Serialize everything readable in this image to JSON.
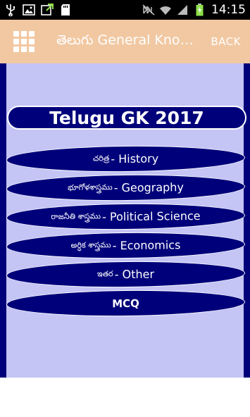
{
  "status_bar": {
    "time": "14:15",
    "icons": [
      "usb-icon",
      "image-icon",
      "download-icon",
      "sd-card-icon",
      "mute-icon",
      "wifi-icon",
      "signal-icon",
      "battery-charging-icon"
    ]
  },
  "action_bar": {
    "title": "తెలుగు General Knowledge",
    "back_label": "BACK",
    "menu_icon": "grid-icon",
    "background": "#f1c8a2"
  },
  "main": {
    "header": "Telugu GK 2017",
    "categories": [
      {
        "telugu": "చరిత్ర",
        "english": " - History"
      },
      {
        "telugu": "భూగోళశాస్త్రము",
        "english": " - Geography"
      },
      {
        "telugu": "రాజనీతి శాస్త్రము",
        "english": " - Political Science"
      },
      {
        "telugu": "అర్ధిక శాస్త్రము",
        "english": " - Economics"
      },
      {
        "telugu": "ఇతర",
        "english": " - Other"
      }
    ],
    "mcq_label": "MCQ"
  },
  "colors": {
    "panel": "#c4c4f5",
    "navy": "#00007a",
    "status_bar": "#000000"
  }
}
